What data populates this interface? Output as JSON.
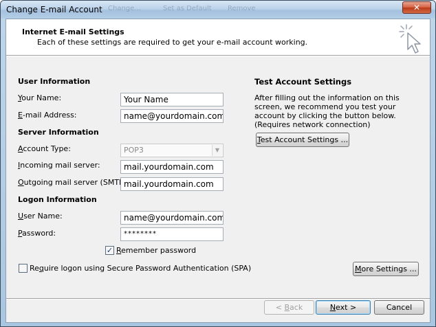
{
  "window": {
    "title": "Change E-mail Account",
    "ghost_items": [
      "Change...",
      "Set as Default",
      "Remove"
    ],
    "close_glyph": "✕"
  },
  "header": {
    "title": "Internet E-mail Settings",
    "subtitle": "Each of these settings are required to get your e-mail account working.",
    "icon": "cursor-sparkle-icon"
  },
  "user_info": {
    "heading": "User Information",
    "name_label": "Your Name:",
    "name_value": "Your Name",
    "email_label": "E-mail Address:",
    "email_value": "name@yourdomain.com"
  },
  "server_info": {
    "heading": "Server Information",
    "account_type_label": "Account Type:",
    "account_type_value": "POP3",
    "incoming_label": "Incoming mail server:",
    "incoming_value": "mail.yourdomain.com",
    "outgoing_label": "Outgoing mail server (SMTP):",
    "outgoing_value": "mail.yourdomain.com"
  },
  "logon_info": {
    "heading": "Logon Information",
    "username_label": "User Name:",
    "username_value": "name@yourdomain.com",
    "password_label": "Password:",
    "password_value": "********",
    "remember_label": "Remember password",
    "remember_checked": true,
    "spa_label": "Require logon using Secure Password Authentication (SPA)",
    "spa_checked": false
  },
  "test_settings": {
    "heading": "Test Account Settings",
    "description": "After filling out the information on this screen, we recommend you test your account by clicking the button below. (Requires network connection)",
    "button_label": "Test Account Settings ..."
  },
  "buttons": {
    "more_settings": "More Settings ...",
    "back": "< Back",
    "next": "Next >",
    "cancel": "Cancel"
  }
}
